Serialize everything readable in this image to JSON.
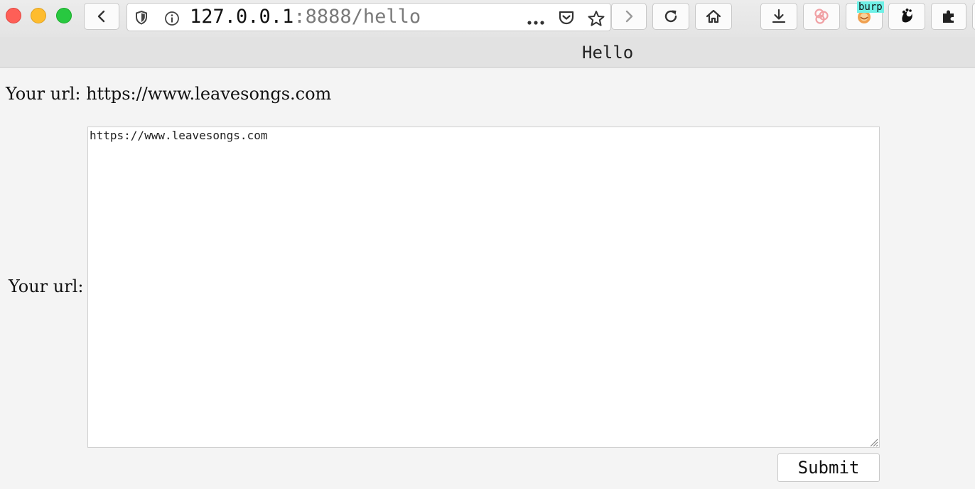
{
  "browser": {
    "window_controls": [
      "close",
      "minimize",
      "maximize"
    ],
    "url_host": "127.0.0.1",
    "url_rest": ":8888/hello",
    "page_actions_icon": "ellipsis-icon",
    "extension_badge": "burp",
    "icons": {
      "back": "chevron-left-icon",
      "forward": "chevron-right-icon",
      "reload": "reload-icon",
      "home": "home-icon",
      "download": "download-icon",
      "extension_1": "rings-icon",
      "extension_2": "burp-icon",
      "extension_3": "paw-icon",
      "extensions": "puzzle-icon",
      "shield": "shield-icon",
      "info": "info-icon",
      "pocket": "pocket-icon",
      "bookmark": "star-icon"
    }
  },
  "page": {
    "title": "Hello",
    "line": "Your url: https://www.leavesongs.com",
    "form": {
      "label": "Your url:",
      "textarea_value": "https://www.leavesongs.com",
      "submit_label": "Submit"
    }
  },
  "colors": {
    "close": "#fe5f57",
    "minimize": "#febc2e",
    "maximize": "#28c840",
    "badge": "#6ff0e6"
  }
}
